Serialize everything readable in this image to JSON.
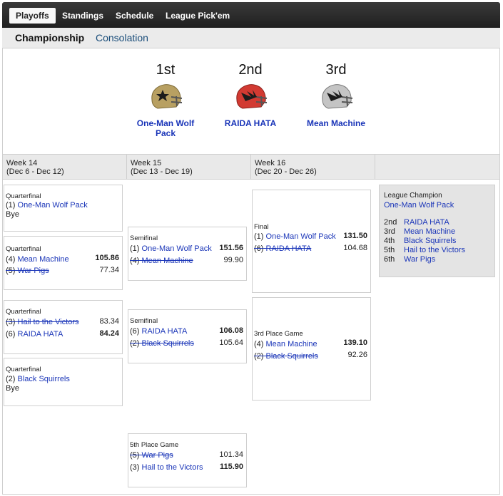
{
  "nav": {
    "top": [
      "Playoffs",
      "Standings",
      "Schedule",
      "League Pick'em"
    ],
    "sub": [
      "Championship",
      "Consolation"
    ]
  },
  "podium": [
    {
      "place": "1st",
      "team": "One-Man Wolf Pack",
      "helmet_color": "#b8a062",
      "logo": "star"
    },
    {
      "place": "2nd",
      "team": "RAIDA HATA",
      "helmet_color": "#d23a32",
      "logo": "bird"
    },
    {
      "place": "3rd",
      "team": "Mean Machine",
      "helmet_color": "#c4c4c4",
      "logo": "bird"
    }
  ],
  "weeks": [
    {
      "title": "Week 14",
      "dates": "(Dec 6 - Dec 12)"
    },
    {
      "title": "Week 15",
      "dates": "(Dec 13 - Dec 19)"
    },
    {
      "title": "Week 16",
      "dates": "(Dec 20 - Dec 26)"
    }
  ],
  "matchups": {
    "qf1": {
      "round": "Quarterfinal",
      "seed1": "(1)",
      "team1": "One-Man Wolf Pack",
      "bye": "Bye"
    },
    "qf2": {
      "round": "Quarterfinal",
      "seed1": "(4)",
      "team1": "Mean Machine",
      "score1": "105.86",
      "seed2": "(5)",
      "team2": "War Pigs",
      "score2": "77.34"
    },
    "qf3": {
      "round": "Quarterfinal",
      "seed1": "(3)",
      "team1": "Hail to the Victors",
      "score1": "83.34",
      "seed2": "(6)",
      "team2": "RAIDA HATA",
      "score2": "84.24"
    },
    "qf4": {
      "round": "Quarterfinal",
      "seed1": "(2)",
      "team1": "Black Squirrels",
      "bye": "Bye"
    },
    "sf1": {
      "round": "Semifinal",
      "seed1": "(1)",
      "team1": "One-Man Wolf Pack",
      "score1": "151.56",
      "seed2": "(4)",
      "team2": "Mean Machine",
      "score2": "99.90"
    },
    "sf2": {
      "round": "Semifinal",
      "seed1": "(6)",
      "team1": "RAIDA HATA",
      "score1": "106.08",
      "seed2": "(2)",
      "team2": "Black Squirrels",
      "score2": "105.64"
    },
    "fifth": {
      "round": "5th Place Game",
      "seed1": "(5)",
      "team1": "War Pigs",
      "score1": "101.34",
      "seed2": "(3)",
      "team2": "Hail to the Victors",
      "score2": "115.90"
    },
    "final": {
      "round": "Final",
      "seed1": "(1)",
      "team1": "One-Man Wolf Pack",
      "score1": "131.50",
      "seed2": "(6)",
      "team2": "RAIDA HATA",
      "score2": "104.68"
    },
    "third": {
      "round": "3rd Place Game",
      "seed1": "(4)",
      "team1": "Mean Machine",
      "score1": "139.10",
      "seed2": "(2)",
      "team2": "Black Squirrels",
      "score2": "92.26"
    }
  },
  "champion": {
    "label": "League Champion",
    "team": "One-Man Wolf Pack",
    "places": [
      {
        "place": "2nd",
        "team": "RAIDA HATA"
      },
      {
        "place": "3rd",
        "team": "Mean Machine"
      },
      {
        "place": "4th",
        "team": "Black Squirrels"
      },
      {
        "place": "5th",
        "team": "Hail to the Victors"
      },
      {
        "place": "6th",
        "team": "War Pigs"
      }
    ]
  }
}
